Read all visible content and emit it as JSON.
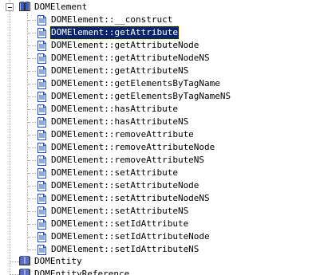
{
  "tree": {
    "parent": {
      "label": "DOMElement",
      "icon": "book-icon",
      "expanded": true
    },
    "children": [
      {
        "label": "DOMElement::__construct",
        "selected": false
      },
      {
        "label": "DOMElement::getAttribute",
        "selected": true
      },
      {
        "label": "DOMElement::getAttributeNode",
        "selected": false
      },
      {
        "label": "DOMElement::getAttributeNodeNS",
        "selected": false
      },
      {
        "label": "DOMElement::getAttributeNS",
        "selected": false
      },
      {
        "label": "DOMElement::getElementsByTagName",
        "selected": false
      },
      {
        "label": "DOMElement::getElementsByTagNameNS",
        "selected": false
      },
      {
        "label": "DOMElement::hasAttribute",
        "selected": false
      },
      {
        "label": "DOMElement::hasAttributeNS",
        "selected": false
      },
      {
        "label": "DOMElement::removeAttribute",
        "selected": false
      },
      {
        "label": "DOMElement::removeAttributeNode",
        "selected": false
      },
      {
        "label": "DOMElement::removeAttributeNS",
        "selected": false
      },
      {
        "label": "DOMElement::setAttribute",
        "selected": false
      },
      {
        "label": "DOMElement::setAttributeNode",
        "selected": false
      },
      {
        "label": "DOMElement::setAttributeNodeNS",
        "selected": false
      },
      {
        "label": "DOMElement::setAttributeNS",
        "selected": false
      },
      {
        "label": "DOMElement::setIdAttribute",
        "selected": false
      },
      {
        "label": "DOMElement::setIdAttributeNode",
        "selected": false
      },
      {
        "label": "DOMElement::setIdAttributeNS",
        "selected": false
      }
    ],
    "siblings": [
      {
        "label": "DOMEntity",
        "icon": "book-icon"
      },
      {
        "label": "DOMEntityReference",
        "icon": "book-icon"
      }
    ],
    "colors": {
      "selection_background": "#0a246a",
      "selection_text": "#ffffff",
      "guide_lines": "#a0a0a0",
      "page_icon_blue": "#1f4fb8"
    }
  }
}
